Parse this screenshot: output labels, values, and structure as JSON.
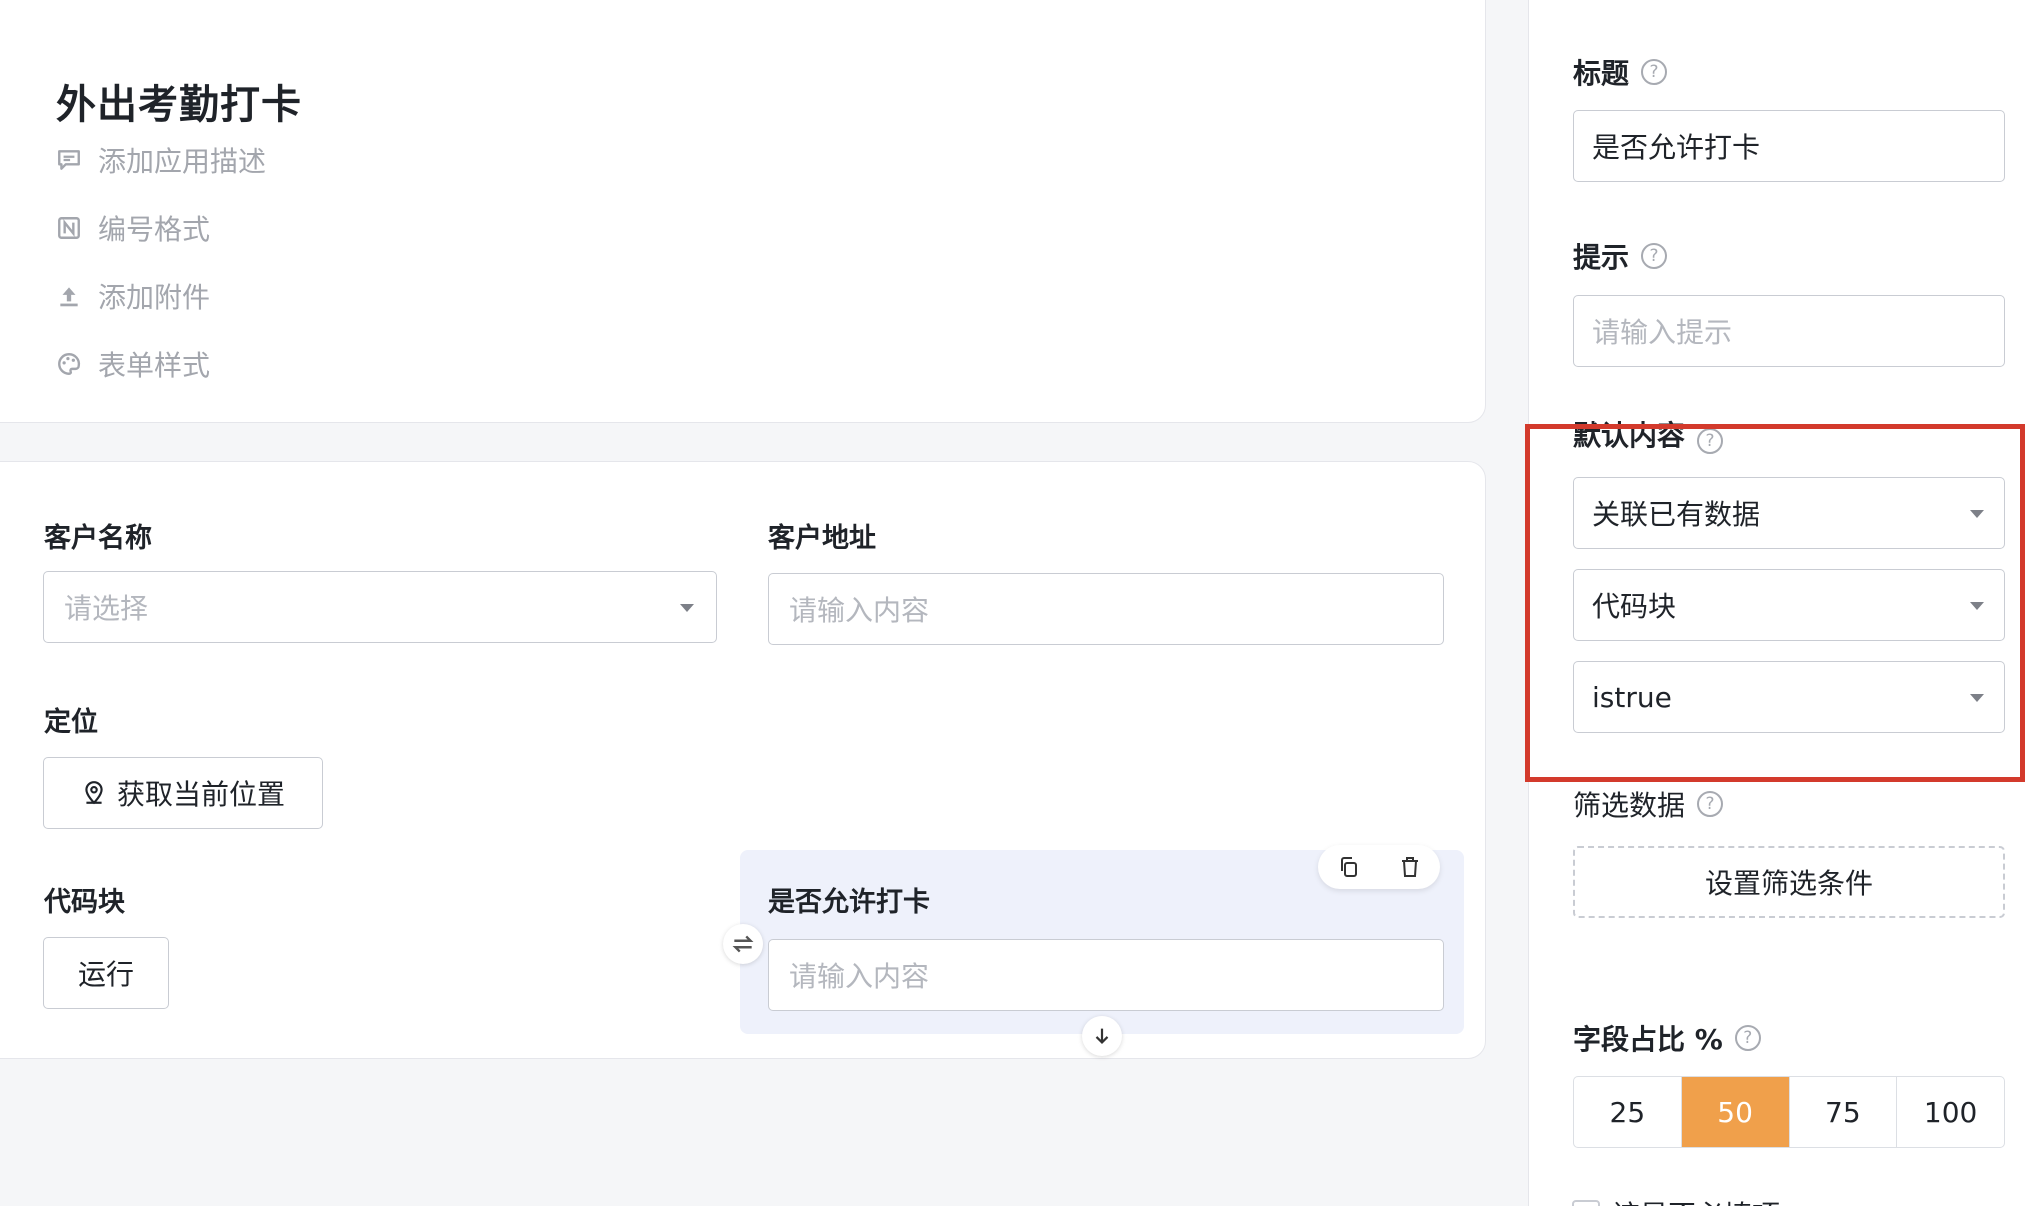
{
  "header": {
    "app_title": "外出考勤打卡",
    "links": [
      {
        "label": "添加应用描述",
        "icon": "comment-icon"
      },
      {
        "label": "编号格式",
        "icon": "numbering-icon"
      },
      {
        "label": "添加附件",
        "icon": "upload-icon"
      },
      {
        "label": "表单样式",
        "icon": "palette-icon"
      }
    ]
  },
  "form": {
    "customer_name": {
      "label": "客户名称",
      "placeholder": "请选择"
    },
    "customer_address": {
      "label": "客户地址",
      "placeholder": "请输入内容"
    },
    "location": {
      "label": "定位",
      "button": "获取当前位置"
    },
    "code_block": {
      "label": "代码块",
      "button": "运行"
    },
    "allow_checkin": {
      "label": "是否允许打卡",
      "placeholder": "请输入内容"
    }
  },
  "panel": {
    "title": {
      "label": "标题",
      "value": "是否允许打卡"
    },
    "hint": {
      "label": "提示",
      "placeholder": "请输入提示"
    },
    "default_content": {
      "label": "默认内容",
      "selects": [
        "关联已有数据",
        "代码块",
        "istrue"
      ]
    },
    "filter": {
      "label": "筛选数据",
      "button": "设置筛选条件"
    },
    "width_ratio": {
      "label": "字段占比 %",
      "options": [
        "25",
        "50",
        "75",
        "100"
      ],
      "selected": "50"
    },
    "cutoff_label": "该是否必填项"
  },
  "colors": {
    "accent": "#f0a04b",
    "highlight": "#d33a2c",
    "selected_bg": "#eef1fb"
  }
}
